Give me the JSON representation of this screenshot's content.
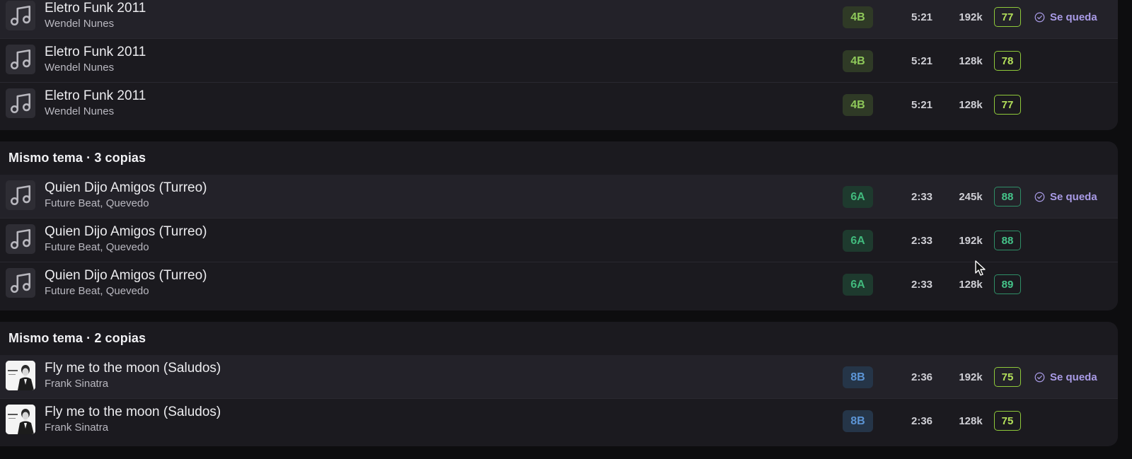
{
  "colors": {
    "background": "#0d0d0f",
    "panel": "#1b1a1f",
    "keeper_row": "#232229",
    "keep_accent": "#a99be6",
    "key_4b": "#8fc95a",
    "key_6a": "#41b97c",
    "key_8b": "#5c95d6",
    "score_lime": "#b3e05a",
    "score_teal": "#45c48a"
  },
  "groups": [
    {
      "header": "",
      "rows": [
        {
          "title": "Eletro Funk 2011",
          "artist": "Wendel Nunes",
          "key": "4B",
          "duration": "5:21",
          "bitrate": "192k",
          "score": "77",
          "keep": "Se queda",
          "art": "music-note-icon"
        },
        {
          "title": "Eletro Funk 2011",
          "artist": "Wendel Nunes",
          "key": "4B",
          "duration": "5:21",
          "bitrate": "128k",
          "score": "78",
          "keep": "",
          "art": "music-note-icon"
        },
        {
          "title": "Eletro Funk 2011",
          "artist": "Wendel Nunes",
          "key": "4B",
          "duration": "5:21",
          "bitrate": "128k",
          "score": "77",
          "keep": "",
          "art": "music-note-icon"
        }
      ]
    },
    {
      "header": "Mismo tema · 3 copias",
      "rows": [
        {
          "title": "Quien Dijo Amigos (Turreo)",
          "artist": "Future Beat, Quevedo",
          "key": "6A",
          "duration": "2:33",
          "bitrate": "245k",
          "score": "88",
          "keep": "Se queda",
          "art": "music-note-icon"
        },
        {
          "title": "Quien Dijo Amigos (Turreo)",
          "artist": "Future Beat, Quevedo",
          "key": "6A",
          "duration": "2:33",
          "bitrate": "192k",
          "score": "88",
          "keep": "",
          "art": "music-note-icon"
        },
        {
          "title": "Quien Dijo Amigos (Turreo)",
          "artist": "Future Beat, Quevedo",
          "key": "6A",
          "duration": "2:33",
          "bitrate": "128k",
          "score": "89",
          "keep": "",
          "art": "music-note-icon"
        }
      ]
    },
    {
      "header": "Mismo tema · 2 copias",
      "rows": [
        {
          "title": "Fly me to the moon (Saludos)",
          "artist": "Frank Sinatra",
          "key": "8B",
          "duration": "2:36",
          "bitrate": "192k",
          "score": "75",
          "keep": "Se queda",
          "art": "album-cover"
        },
        {
          "title": "Fly me to the moon (Saludos)",
          "artist": "Frank Sinatra",
          "key": "8B",
          "duration": "2:36",
          "bitrate": "128k",
          "score": "75",
          "keep": "",
          "art": "album-cover"
        }
      ]
    }
  ]
}
